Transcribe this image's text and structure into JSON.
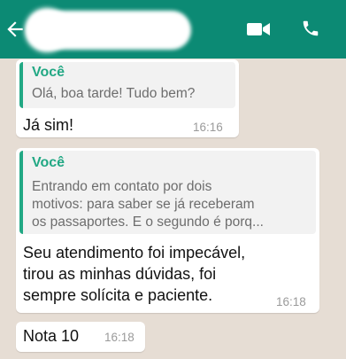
{
  "header": {
    "back_icon": "back-arrow-icon",
    "video_icon": "video-call-icon",
    "call_icon": "phone-call-icon",
    "colors": {
      "bar": "#0c8a74",
      "accent": "#22a884"
    }
  },
  "messages": [
    {
      "quote": {
        "author": "Você",
        "text": "Olá, boa tarde! Tudo bem?"
      },
      "text": "Já sim!",
      "time": "16:16"
    },
    {
      "quote": {
        "author": "Você",
        "lines": [
          "Entrando em contato por dois",
          "motivos: para saber se já receberam",
          "os passaportes. E o segundo é porq..."
        ]
      },
      "lines": [
        "Seu atendimento foi impecável,",
        "tirou as minhas dúvidas, foi",
        "sempre solícita e paciente."
      ],
      "time": "16:18"
    },
    {
      "text": "Nota 10",
      "time": "16:18"
    }
  ]
}
